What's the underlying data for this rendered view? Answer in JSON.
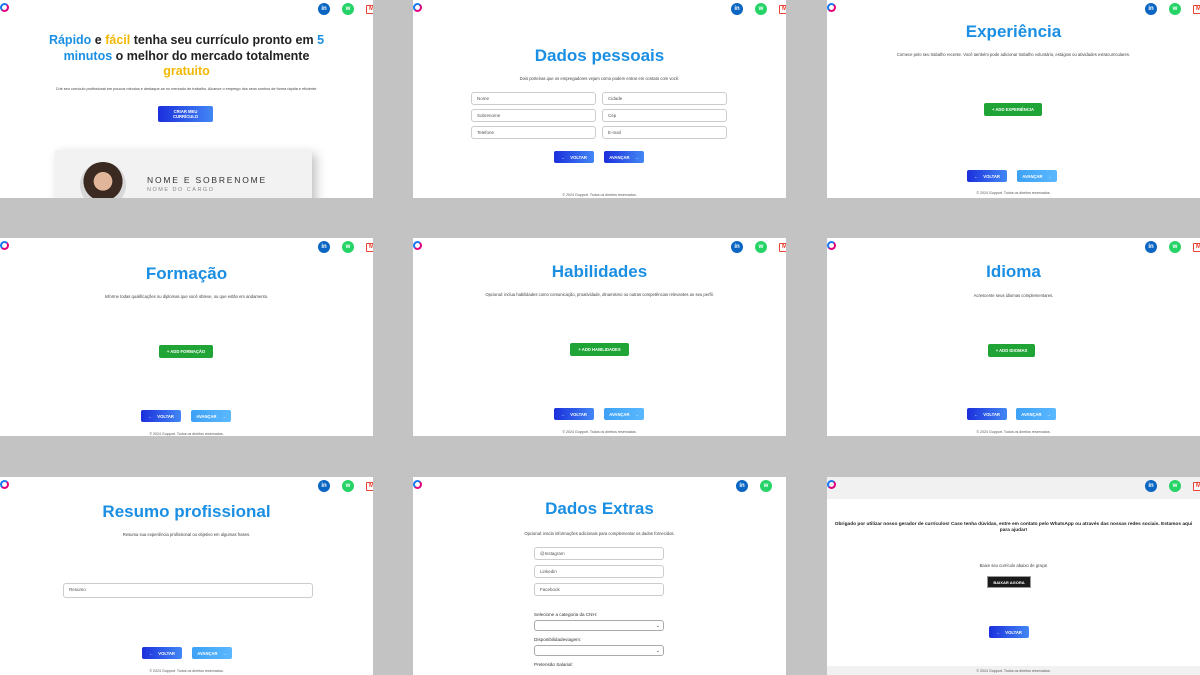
{
  "social": {
    "linkedin": "in",
    "whatsapp": "w",
    "gmail": "M"
  },
  "common": {
    "back": "VOLTAR",
    "next": "AVANÇAR",
    "arrow_left": "←",
    "arrow_right": "→",
    "footer": "© 2024 Gupport. Todos os direitos reservados."
  },
  "p1": {
    "headline_a": "Rápido",
    "headline_b": " e ",
    "headline_c": "fácil",
    "headline_d": " tenha seu currículo pronto em ",
    "headline_e": "5 minutos",
    "headline_f": " o melhor do mercado totalmente ",
    "headline_g": "gratuito",
    "description": "Crie seu currículo profissional em poucos minutos e destaque-se no mercado de trabalho. Alcance o emprego dos seus sonhos de forma rápida e eficiente.",
    "cta": "CRIAR MEU CURRÍCULO",
    "card_name": "NOME E SOBRENOME",
    "card_role": "NOME DO CARGO"
  },
  "p2": {
    "title": "Dados pessoais",
    "subtitle": "Dois porteiras que os empregadores vejam como podem entrar em contato com você.",
    "fields": [
      "Nome",
      "Cidade",
      "Sobrenome",
      "Cep",
      "Telefone",
      "E-mail"
    ]
  },
  "p3": {
    "title": "Experiência",
    "subtitle": "Comece pelo seu trabalho recente. Você também pode adicionar trabalho voluntário, estágios ou atividades extracurriculares.",
    "add": "+ ADD EXPERIÊNCIA"
  },
  "p4": {
    "title": "Formação",
    "subtitle": "Informe todas qualificações ou diplomas que você obteve, ou que estão em andamento.",
    "add": "+ ADD FORMAÇÃO"
  },
  "p5": {
    "title": "Habilidades",
    "subtitle": "Opcional: inclua habilidades como comunicação, proatividade, dinamismo ou outras competências relevantes ao seu perfil.",
    "add": "+ ADD HABILIDADES"
  },
  "p6": {
    "title": "Idioma",
    "subtitle": "Acrescente seus idiomas complementares.",
    "add": "+ ADD IDIOMAS"
  },
  "p7": {
    "title": "Resumo profissional",
    "subtitle": "Resuma sua experiência profissional ou objetivo em algumas frases.",
    "field": "Resumo"
  },
  "p8": {
    "title": "Dados Extras",
    "subtitle": "Opcional: inscla informações adicionais para complementar os dados fornecidos.",
    "fields": [
      "@Instagram",
      "Linkedin",
      "Facebook"
    ],
    "label_cnh": "Selecione a categoria da CNH:",
    "label_disp": "Disponibilidadeviagem:",
    "label_pret": "Pretensão Salarial:"
  },
  "p9": {
    "message": "Obrigado por utilizar nosso gerador de currículos! Caso tenha dúvidas, entre em contato pelo WhatsApp ou através das nossas redes sociais. Estamos aqui para ajudar!",
    "download_text": "Baixe seu currículo abaixo de graça!",
    "download_btn": "BAIXAR AGORA"
  }
}
